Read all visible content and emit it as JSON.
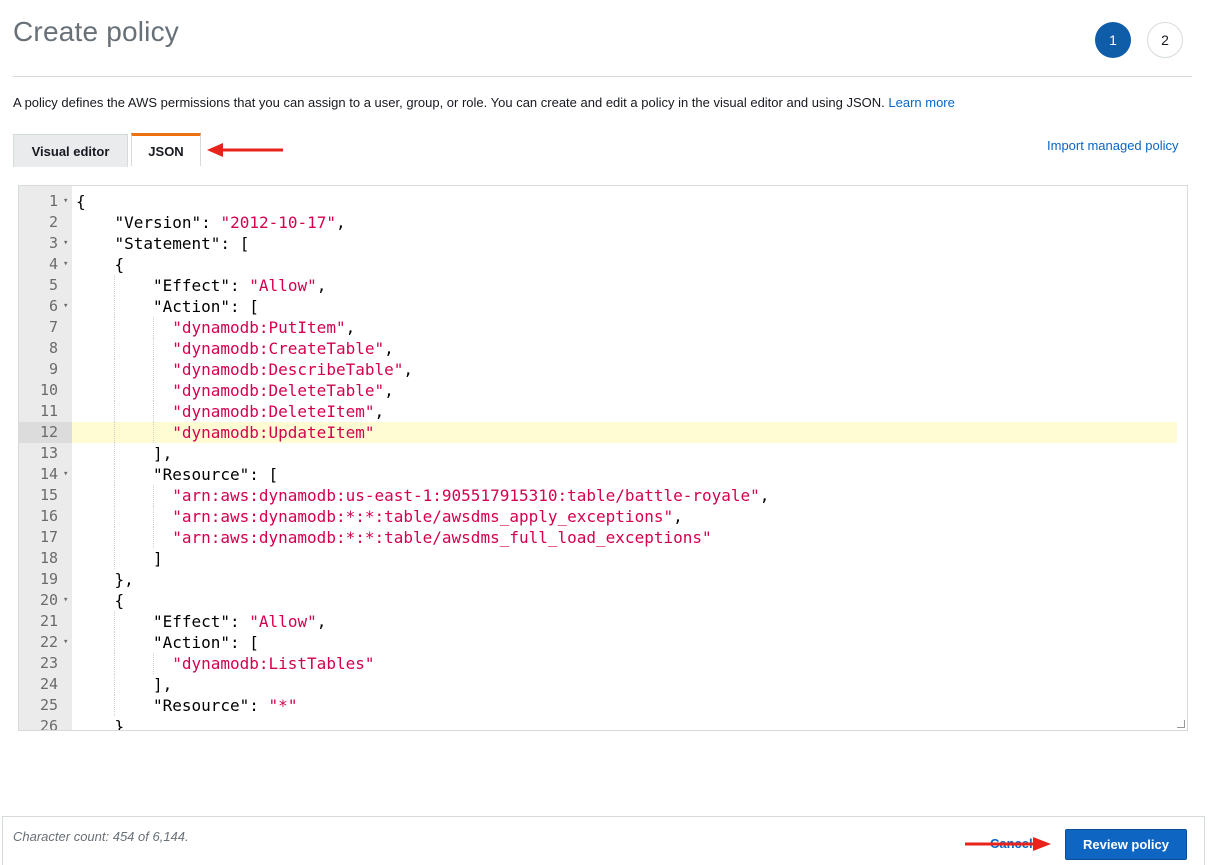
{
  "header": {
    "title": "Create policy",
    "steps": [
      "1",
      "2"
    ],
    "description": "A policy defines the AWS permissions that you can assign to a user, group, or role. You can create and edit a policy in the visual editor and using JSON.",
    "learn_more": "Learn more"
  },
  "tabs": [
    {
      "label": "Visual editor",
      "active": false
    },
    {
      "label": "JSON",
      "active": true
    }
  ],
  "import_link": "Import managed policy",
  "editor": {
    "highlighted_line": 12,
    "lines": [
      {
        "n": "1",
        "fold": true,
        "indent": 0,
        "segments": [
          {
            "t": "{",
            "s": false
          }
        ]
      },
      {
        "n": "2",
        "fold": false,
        "indent": 1,
        "segments": [
          {
            "t": "\"Version\": ",
            "s": false
          },
          {
            "t": "\"2012-10-17\"",
            "s": true
          },
          {
            "t": ",",
            "s": false
          }
        ]
      },
      {
        "n": "3",
        "fold": true,
        "indent": 1,
        "segments": [
          {
            "t": "\"Statement\": [",
            "s": false
          }
        ]
      },
      {
        "n": "4",
        "fold": true,
        "indent": 1,
        "segments": [
          {
            "t": "{",
            "s": false
          }
        ]
      },
      {
        "n": "5",
        "fold": false,
        "indent": 2,
        "segments": [
          {
            "t": "\"Effect\": ",
            "s": false
          },
          {
            "t": "\"Allow\"",
            "s": true
          },
          {
            "t": ",",
            "s": false
          }
        ]
      },
      {
        "n": "6",
        "fold": true,
        "indent": 2,
        "segments": [
          {
            "t": "\"Action\": [",
            "s": false
          }
        ]
      },
      {
        "n": "7",
        "fold": false,
        "indent": 2.5,
        "segments": [
          {
            "t": "\"dynamodb:PutItem\"",
            "s": true
          },
          {
            "t": ",",
            "s": false
          }
        ]
      },
      {
        "n": "8",
        "fold": false,
        "indent": 2.5,
        "segments": [
          {
            "t": "\"dynamodb:CreateTable\"",
            "s": true
          },
          {
            "t": ",",
            "s": false
          }
        ]
      },
      {
        "n": "9",
        "fold": false,
        "indent": 2.5,
        "segments": [
          {
            "t": "\"dynamodb:DescribeTable\"",
            "s": true
          },
          {
            "t": ",",
            "s": false
          }
        ]
      },
      {
        "n": "10",
        "fold": false,
        "indent": 2.5,
        "segments": [
          {
            "t": "\"dynamodb:DeleteTable\"",
            "s": true
          },
          {
            "t": ",",
            "s": false
          }
        ]
      },
      {
        "n": "11",
        "fold": false,
        "indent": 2.5,
        "segments": [
          {
            "t": "\"dynamodb:DeleteItem\"",
            "s": true
          },
          {
            "t": ",",
            "s": false
          }
        ]
      },
      {
        "n": "12",
        "fold": false,
        "indent": 2.5,
        "segments": [
          {
            "t": "\"dynamodb:UpdateItem\"",
            "s": true
          }
        ]
      },
      {
        "n": "13",
        "fold": false,
        "indent": 2,
        "segments": [
          {
            "t": "],",
            "s": false
          }
        ]
      },
      {
        "n": "14",
        "fold": true,
        "indent": 2,
        "segments": [
          {
            "t": "\"Resource\": [",
            "s": false
          }
        ]
      },
      {
        "n": "15",
        "fold": false,
        "indent": 2.5,
        "segments": [
          {
            "t": "\"arn:aws:dynamodb:us-east-1:905517915310:table/battle-royale\"",
            "s": true
          },
          {
            "t": ",",
            "s": false
          }
        ]
      },
      {
        "n": "16",
        "fold": false,
        "indent": 2.5,
        "segments": [
          {
            "t": "\"arn:aws:dynamodb:*:*:table/awsdms_apply_exceptions\"",
            "s": true
          },
          {
            "t": ",",
            "s": false
          }
        ]
      },
      {
        "n": "17",
        "fold": false,
        "indent": 2.5,
        "segments": [
          {
            "t": "\"arn:aws:dynamodb:*:*:table/awsdms_full_load_exceptions\"",
            "s": true
          }
        ]
      },
      {
        "n": "18",
        "fold": false,
        "indent": 2,
        "segments": [
          {
            "t": "]",
            "s": false
          }
        ]
      },
      {
        "n": "19",
        "fold": false,
        "indent": 1,
        "segments": [
          {
            "t": "},",
            "s": false
          }
        ]
      },
      {
        "n": "20",
        "fold": true,
        "indent": 1,
        "segments": [
          {
            "t": "{",
            "s": false
          }
        ]
      },
      {
        "n": "21",
        "fold": false,
        "indent": 2,
        "segments": [
          {
            "t": "\"Effect\": ",
            "s": false
          },
          {
            "t": "\"Allow\"",
            "s": true
          },
          {
            "t": ",",
            "s": false
          }
        ]
      },
      {
        "n": "22",
        "fold": true,
        "indent": 2,
        "segments": [
          {
            "t": "\"Action\": [",
            "s": false
          }
        ]
      },
      {
        "n": "23",
        "fold": false,
        "indent": 2.5,
        "segments": [
          {
            "t": "\"dynamodb:ListTables\"",
            "s": true
          }
        ]
      },
      {
        "n": "24",
        "fold": false,
        "indent": 2,
        "segments": [
          {
            "t": "],",
            "s": false
          }
        ]
      },
      {
        "n": "25",
        "fold": false,
        "indent": 2,
        "segments": [
          {
            "t": "\"Resource\": ",
            "s": false
          },
          {
            "t": "\"*\"",
            "s": true
          }
        ]
      },
      {
        "n": "26",
        "fold": false,
        "indent": 1,
        "segments": [
          {
            "t": "}",
            "s": false
          }
        ]
      }
    ]
  },
  "footer": {
    "char_count": "Character count: 454 of 6,144.",
    "cancel_label": "Cancel",
    "review_label": "Review policy"
  },
  "colors": {
    "accent": "#0f66c2",
    "tab_highlight": "#ec7211",
    "string": "#d4004f",
    "annotation_arrow": "#e8231b"
  }
}
